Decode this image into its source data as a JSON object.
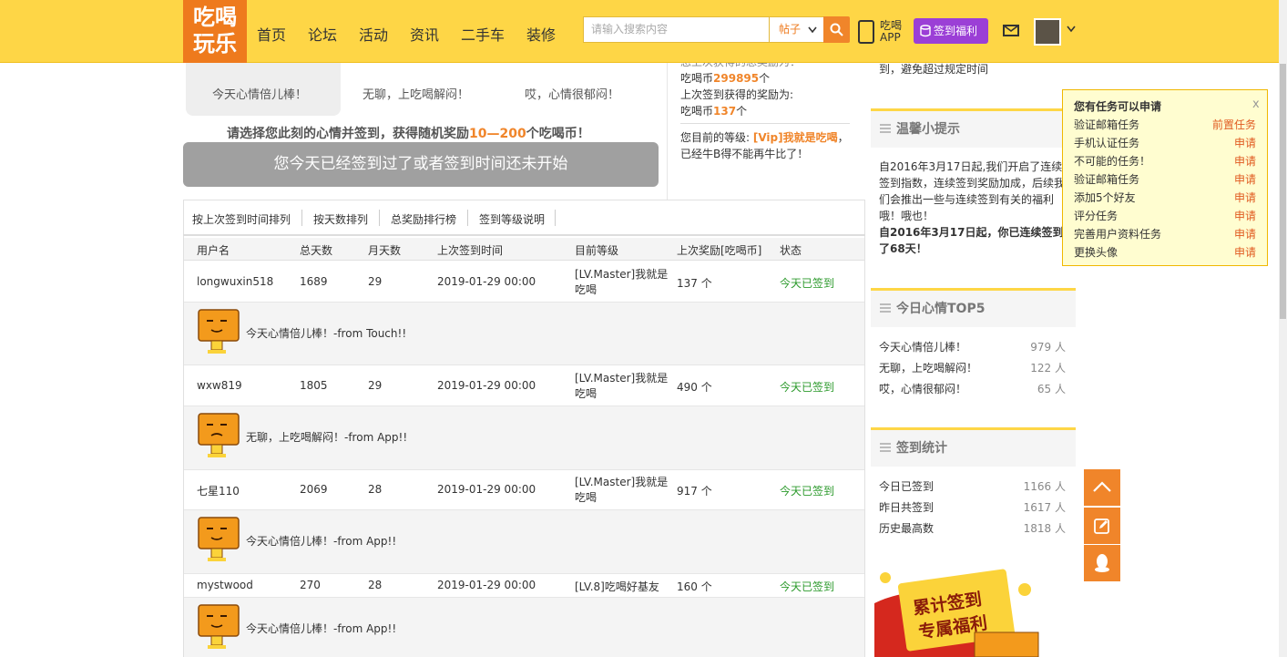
{
  "header": {
    "logo_line1": "吃喝",
    "logo_line2": "玩乐",
    "nav": [
      "首页",
      "论坛",
      "活动",
      "资讯",
      "二手车",
      "装修"
    ],
    "search_placeholder": "请输入搜索内容",
    "search_type": "帖子",
    "app_line1": "吃喝",
    "app_line2": "APP",
    "sign_welfare": "签到福利"
  },
  "mood": {
    "options": [
      "今天心情倍儿棒！",
      "无聊，上吃喝解闷！",
      "哎，心情很郁闷！"
    ],
    "prompt_prefix": "请选择您此刻的心情并签到，获得随机奖励",
    "prompt_range": "10—200",
    "prompt_suffix": "个吃喝币！",
    "sign_status": "您今天已经签到过了或者签到时间还未开始"
  },
  "reward_info": {
    "line0": "您上次获得的总奖励为：",
    "coins1_prefix": "吃喝币",
    "coins1_value": "299895",
    "coins1_suffix": "个",
    "last_label": "上次签到获得的奖励为:",
    "coins2_prefix": "吃喝币",
    "coins2_value": "137",
    "coins2_suffix": "个",
    "level_label": "您目前的等级:",
    "level_value": "[Vip]我就是吃喝",
    "level_tail": "，",
    "level_line2": "已经牛B得不能再牛比了！"
  },
  "table": {
    "tabs": [
      "按上次签到时间排列",
      "按天数排列",
      "总奖励排行榜",
      "签到等级说明"
    ],
    "columns": [
      "用户名",
      "总天数",
      "月天数",
      "上次签到时间",
      "目前等级",
      "上次奖励[吃喝币]",
      "状态"
    ],
    "rows": [
      {
        "user": "longwuxin518",
        "total": "1689",
        "month": "29",
        "time": "2019-01-29 00:00",
        "level": "[LV.Master]我就是吃喝",
        "reward": "137 个",
        "status": "今天已签到",
        "memo": "今天心情倍儿棒！-from Touch!!"
      },
      {
        "user": "wxw819",
        "total": "1805",
        "month": "29",
        "time": "2019-01-29 00:00",
        "level": "[LV.Master]我就是吃喝",
        "reward": "490 个",
        "status": "今天已签到",
        "memo": "无聊，上吃喝解闷！-from App!!"
      },
      {
        "user": "七星110",
        "total": "2069",
        "month": "28",
        "time": "2019-01-29 00:00",
        "level": "[LV.Master]我就是吃喝",
        "reward": "917 个",
        "status": "今天已签到",
        "memo": "今天心情倍儿棒！-from App!!"
      },
      {
        "user": "mystwood",
        "total": "270",
        "month": "28",
        "time": "2019-01-29 00:00",
        "level": "[LV.8]吃喝好基友",
        "reward": "160 个",
        "status": "今天已签到",
        "memo": "今天心情倍儿棒！-from App!!"
      }
    ]
  },
  "sidebar": {
    "top_line": "到，避免超过规定时间",
    "tips_title": "温馨小提示",
    "tips_text": "自2016年3月17日起,我们开启了连续签到指数，连续签到奖励加成，后续我们会推出一些与连续签到有关的福利哦！哦也！",
    "tips_bold": "自2016年3月17日起，你已连续签到了68天！",
    "top5_title": "今日心情TOP5",
    "top5": [
      {
        "label": "今天心情倍儿棒！",
        "count": "979 人"
      },
      {
        "label": "无聊，上吃喝解闷！",
        "count": "122 人"
      },
      {
        "label": "哎，心情很郁闷！",
        "count": "65 人"
      }
    ],
    "stats_title": "签到统计",
    "stats": [
      {
        "label": "今日已签到",
        "count": "1166 人"
      },
      {
        "label": "昨日共签到",
        "count": "1617 人"
      },
      {
        "label": "历史最高数",
        "count": "1818 人"
      }
    ],
    "promo_line1": "累计签到",
    "promo_line2": "专属福利"
  },
  "tasks": {
    "title": "您有任务可以申请",
    "close": "x",
    "items": [
      {
        "name": "验证邮箱任务",
        "action": "前置任务"
      },
      {
        "name": "手机认证任务",
        "action": "申请"
      },
      {
        "name": "不可能的任务！",
        "action": "申请"
      },
      {
        "name": "验证邮箱任务",
        "action": "申请"
      },
      {
        "name": "添加5个好友",
        "action": "申请"
      },
      {
        "name": "评分任务",
        "action": "申请"
      },
      {
        "name": "完善用户资料任务",
        "action": "申请"
      },
      {
        "name": "更换头像",
        "action": "申请"
      }
    ]
  },
  "colors": {
    "brand_yellow": "#fed646",
    "accent_orange": "#f0852a",
    "status_green": "#2c9a2c",
    "purple": "#9b3fd6"
  }
}
